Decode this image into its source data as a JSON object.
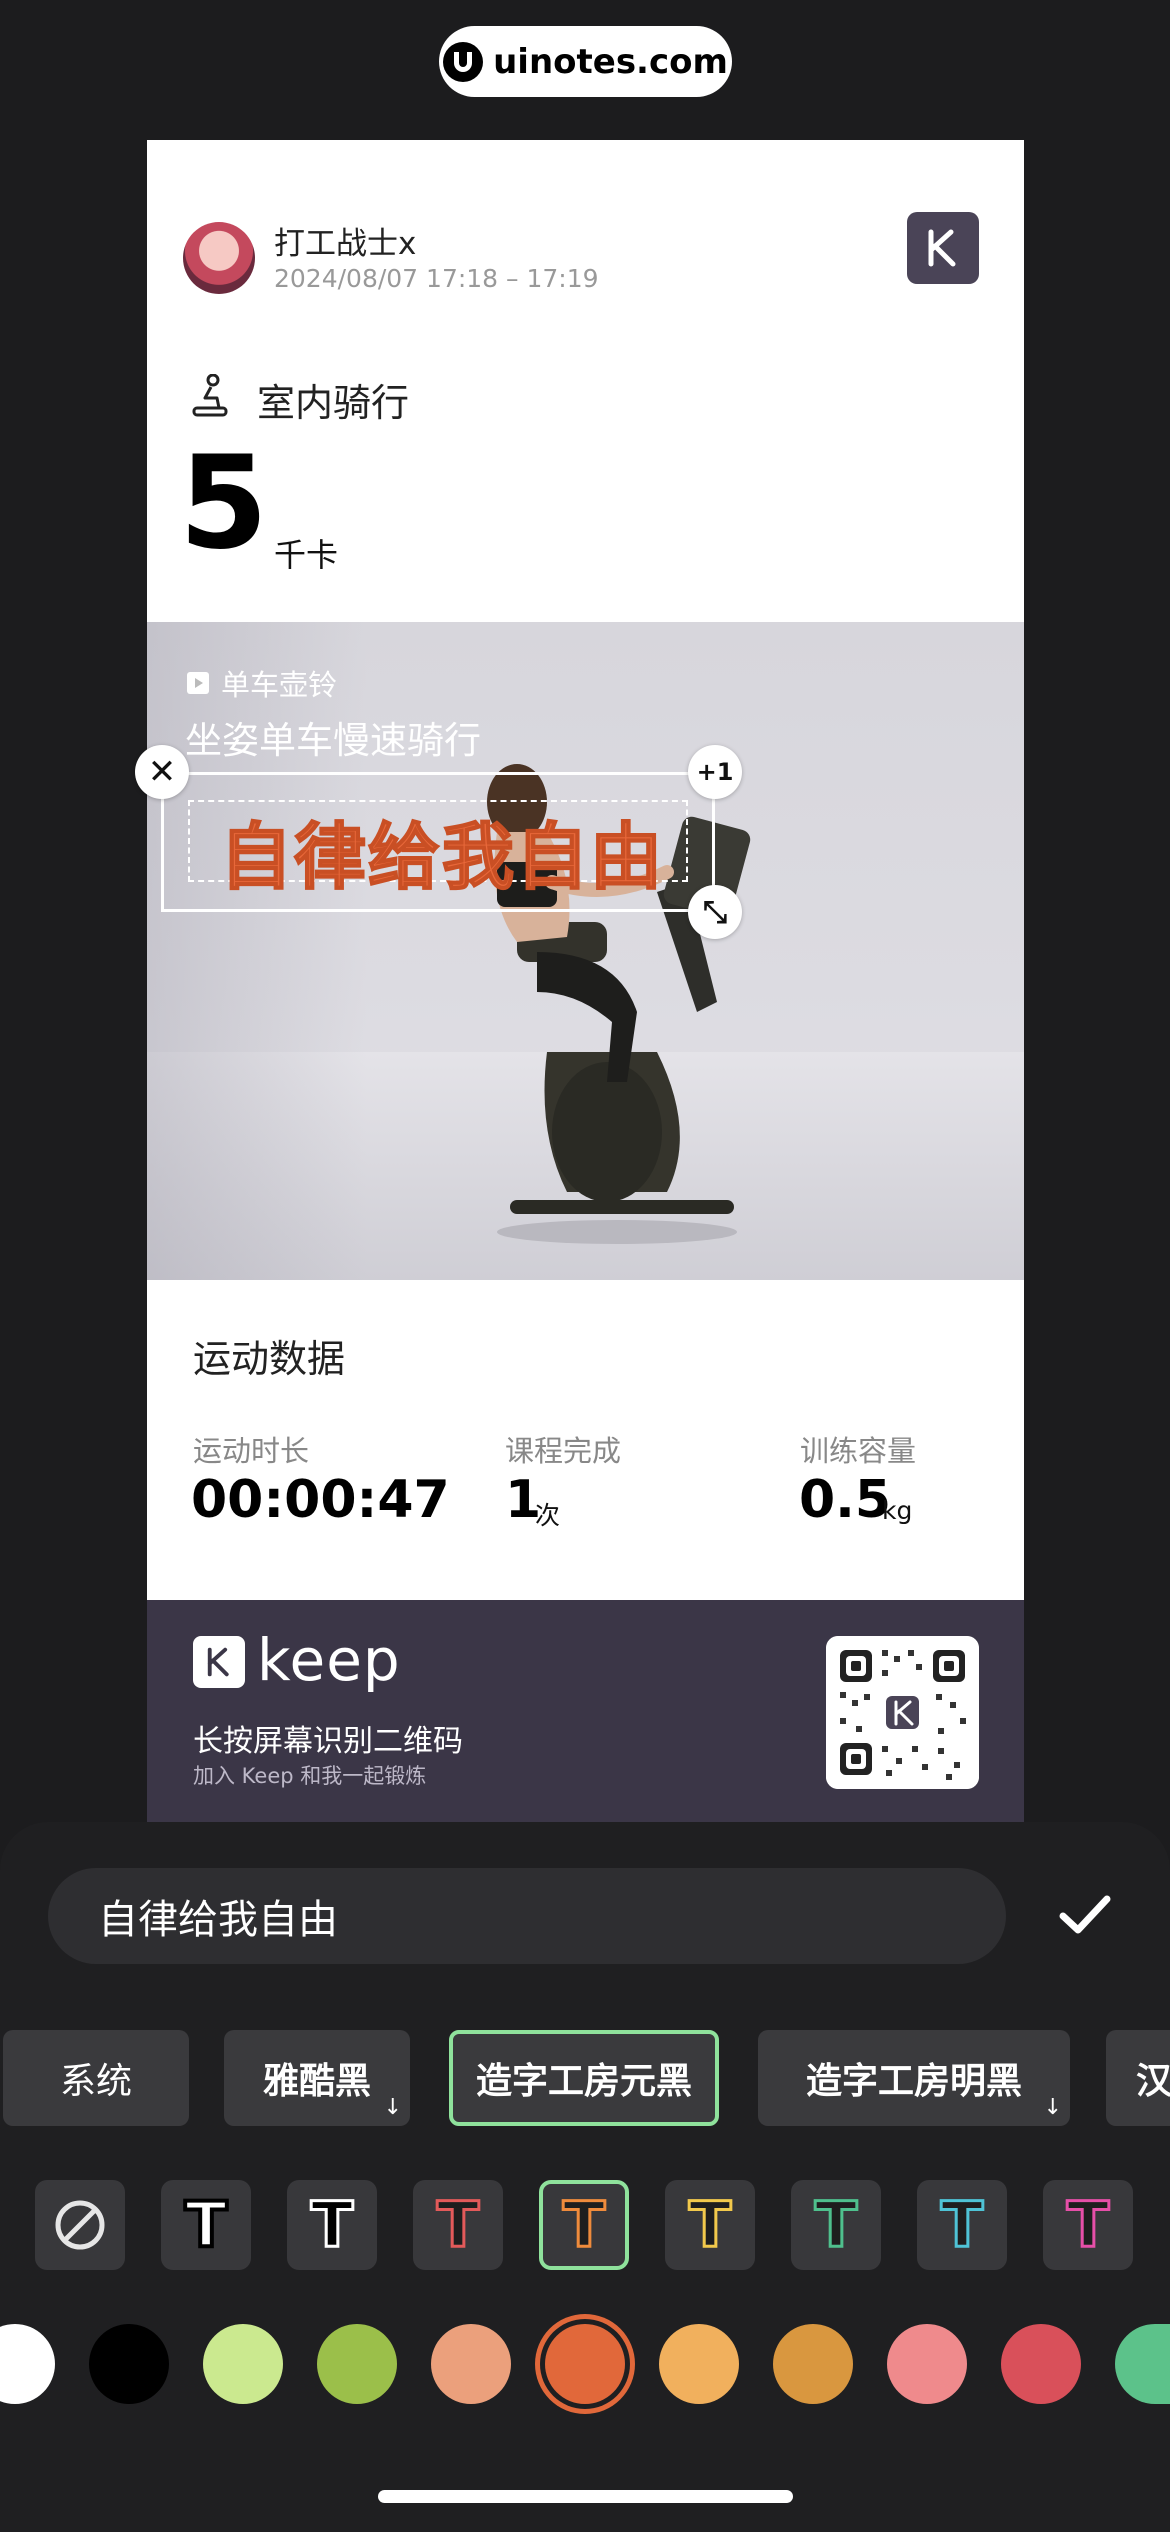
{
  "watermark": {
    "text": "uinotes.com"
  },
  "card": {
    "user_name": "打工战士x",
    "time_range": "2024/08/07 17:18 – 17:19",
    "sport_name": "室内骑行",
    "calories_value": "5",
    "calories_unit": "千卡",
    "course_tag": "单车壶铃",
    "course_title": "坐姿单车慢速骑行"
  },
  "sticker": {
    "text": "自律给我自由",
    "close_symbol": "✕",
    "duplicate_label": "+1",
    "resize_symbol": "⤡",
    "color": "#e8683a"
  },
  "stats": {
    "title": "运动数据",
    "items": [
      {
        "label": "运动时长",
        "value": "00:00:47",
        "unit": ""
      },
      {
        "label": "课程完成",
        "value": "1",
        "unit": "次"
      },
      {
        "label": "训练容量",
        "value": "0.5",
        "unit": "kg"
      }
    ]
  },
  "footer": {
    "brand": "keep",
    "scan_text": "长按屏幕识别二维码",
    "join_text": "加入 Keep 和我一起锻炼"
  },
  "editor": {
    "input_value": "自律给我自由",
    "confirm_icon": "checkmark-icon",
    "fonts": [
      {
        "label": "系统",
        "download": false,
        "selected": false
      },
      {
        "label": "雅酷黑",
        "download": true,
        "selected": false
      },
      {
        "label": "造字工房元黑",
        "download": false,
        "selected": true
      },
      {
        "label": "造字工房明黑",
        "download": true,
        "selected": false
      },
      {
        "label": "汉",
        "download": false,
        "selected": false
      }
    ],
    "download_glyph": "↓",
    "text_styles": [
      {
        "name": "none",
        "fill": "",
        "stroke": ""
      },
      {
        "name": "white-black-outline",
        "fill": "#ffffff",
        "stroke": "#000000"
      },
      {
        "name": "black-white-outline",
        "fill": "#000000",
        "stroke": "#ffffff"
      },
      {
        "name": "red-outline",
        "fill": "#000000",
        "stroke": "#e35a5a"
      },
      {
        "name": "orange-outline",
        "fill": "#000000",
        "stroke": "#ef8b3c"
      },
      {
        "name": "yellow-outline",
        "fill": "#000000",
        "stroke": "#f2c94c"
      },
      {
        "name": "green-outline",
        "fill": "#000000",
        "stroke": "#4fc08d"
      },
      {
        "name": "cyan-outline",
        "fill": "#000000",
        "stroke": "#4fc3d6"
      },
      {
        "name": "pink-outline",
        "fill": "#000000",
        "stroke": "#e64fa8"
      }
    ],
    "selected_style_index": 4,
    "t_glyph": "T",
    "colors": [
      "#ffffff",
      "#000000",
      "#cbe98f",
      "#9bbf4a",
      "#eba07c",
      "#e1683a",
      "#f1b05d",
      "#d9973f",
      "#ef8a8c",
      "#d9505a",
      "#5cc28a"
    ],
    "selected_color_index": 5
  }
}
